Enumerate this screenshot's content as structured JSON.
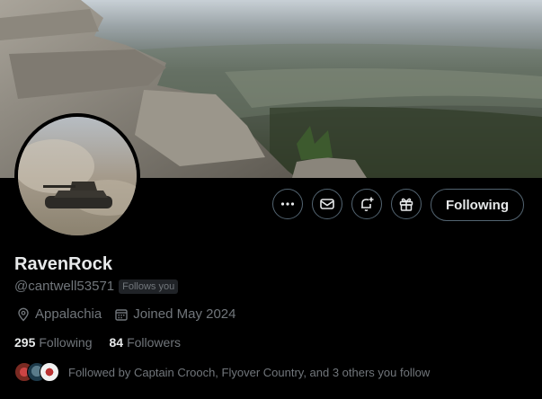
{
  "profile": {
    "display_name": "RavenRock",
    "handle": "@cantwell53571",
    "follows_you_badge": "Follows you",
    "location": "Appalachia",
    "joined": "Joined May 2024"
  },
  "stats": {
    "following_count": "295",
    "following_label": "Following",
    "followers_count": "84",
    "followers_label": "Followers"
  },
  "followed_by": {
    "text": "Followed by Captain Crooch, Flyover Country, and 3 others you follow"
  },
  "actions": {
    "more_icon": "more-horizontal-icon",
    "message_icon": "envelope-icon",
    "notify_icon": "bell-plus-icon",
    "subscribe_icon": "gift-icon",
    "following_label": "Following"
  },
  "colors": {
    "background": "#000000",
    "text_primary": "#e7e9ea",
    "text_secondary": "#71767b",
    "button_border": "#536471",
    "badge_bg": "#202327"
  }
}
